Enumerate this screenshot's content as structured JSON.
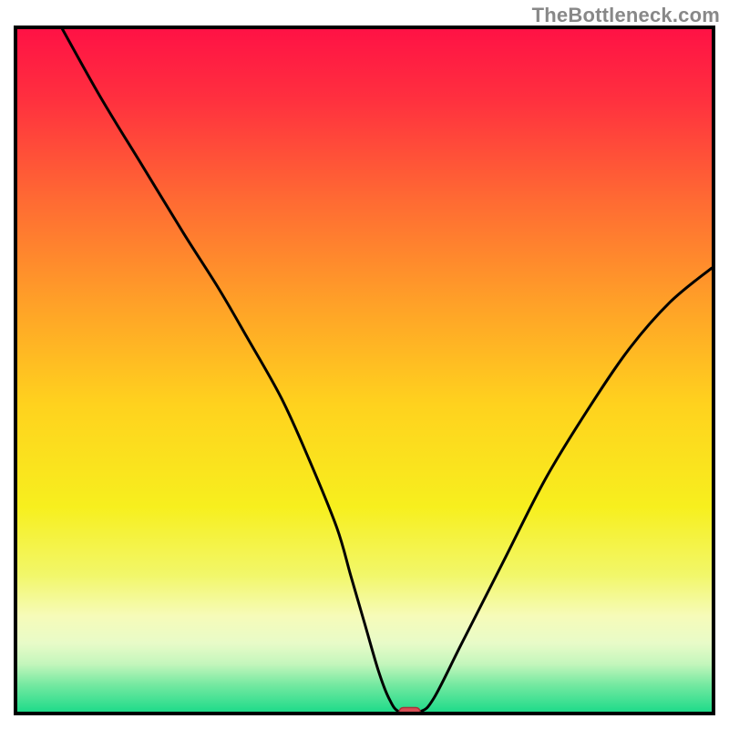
{
  "watermark": "TheBottleneck.com",
  "chart_data": {
    "type": "line",
    "title": "",
    "xlabel": "",
    "ylabel": "",
    "xlim": [
      0,
      100
    ],
    "ylim": [
      0,
      100
    ],
    "gradient_stops": [
      {
        "offset": 0.0,
        "color": "#ff1245"
      },
      {
        "offset": 0.1,
        "color": "#ff2f3f"
      },
      {
        "offset": 0.25,
        "color": "#ff6a33"
      },
      {
        "offset": 0.4,
        "color": "#ffa028"
      },
      {
        "offset": 0.55,
        "color": "#ffd21e"
      },
      {
        "offset": 0.7,
        "color": "#f7ef1e"
      },
      {
        "offset": 0.8,
        "color": "#f2f76a"
      },
      {
        "offset": 0.86,
        "color": "#f6fbb9"
      },
      {
        "offset": 0.9,
        "color": "#e8fbc8"
      },
      {
        "offset": 0.93,
        "color": "#c4f6bc"
      },
      {
        "offset": 0.96,
        "color": "#76e9a1"
      },
      {
        "offset": 1.0,
        "color": "#1fdb8a"
      }
    ],
    "series": [
      {
        "name": "bottleneck-curve",
        "x": [
          6.5,
          12,
          18,
          24,
          29,
          33,
          38,
          42,
          46,
          48,
          50,
          52,
          53.5,
          55,
          58,
          60,
          64,
          70,
          76,
          82,
          88,
          94,
          100
        ],
        "y": [
          100,
          90,
          80,
          70,
          62,
          55,
          46,
          37,
          27,
          20,
          13,
          6,
          2,
          0,
          0,
          2,
          10,
          22,
          34,
          44,
          53,
          60,
          65
        ]
      }
    ],
    "marker": {
      "shape": "capsule",
      "x": 56.5,
      "y": 0,
      "width_pct": 3.0,
      "height_pct": 1.2,
      "fill": "#d94e55",
      "stroke": "#a8343b"
    }
  }
}
